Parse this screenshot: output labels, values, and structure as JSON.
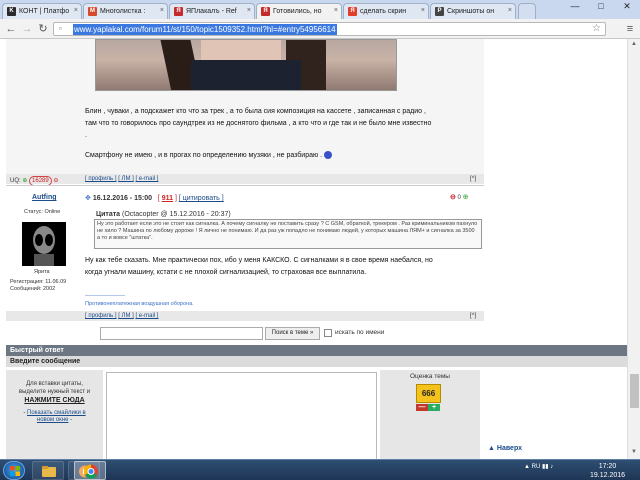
{
  "tabs": [
    {
      "label": "КОНТ | Платфо",
      "icon": "kont-icon",
      "color": "#2a2a2a"
    },
    {
      "label": "Многолистка :",
      "icon": "multilist-icon",
      "color": "#d64b2a"
    },
    {
      "label": "ЯПлакалъ - Ref",
      "icon": "yaplakal-icon",
      "color": "#c62b2b"
    },
    {
      "label": "Готовились, но",
      "icon": "yaplakal-icon",
      "color": "#c62b2b"
    },
    {
      "label": "сделать скрин",
      "icon": "yandex-icon",
      "color": "#e03d2b"
    },
    {
      "label": "Скриншоты он",
      "icon": "p-icon",
      "color": "#444444"
    }
  ],
  "window": {
    "minimize": "—",
    "maximize": "□",
    "close": "✕"
  },
  "address": {
    "url": "www.yaplakal.com/forum11/st/150/topic1509352.html?hl=#entry54956614"
  },
  "post1": {
    "text1": "Блин , чуваки , а подскажет кто что за трек , а то была сия композиция на кассете , записанная с радио ,",
    "text2": "там что то говорилось про саундтрек из не доснятого фильма , а кто что и где так и не было мне известно",
    "text3": ".",
    "text4": "Смартфону не имею , и в прогах по определению музяки , не разбираю .",
    "uq_label": "UQ:",
    "uq_value": "16289",
    "links": [
      "[ профиль ]",
      "[ ЛМ ]",
      "[ e-mail ]"
    ],
    "up": "[^]"
  },
  "post2": {
    "author": "Autfing",
    "status": "Статус: Online",
    "date": "16.12.2016 - 15:00",
    "rep_num": "911",
    "quote_link": "[ цитировать ]",
    "score": "0",
    "user_name": "Ярита",
    "registration": "Регистрация: 11.06.09",
    "messages": "Сообщений: 2002",
    "quote_title": "Цитата",
    "quote_meta": "(Octacopter @ 15.12.2016 - 20:37)",
    "quote_text": "Ну это работает если это не стоит как сигналка. А почему сигналку не поставить сразу ? С GSM, обраткой, трекером . Раз криминальником пахнуло не хило ? Машина по любому дороже ! Я лично не понимаю. И да раз уж попадло не понимаю людей, у которых машина ЛЯМ+ и сигналка за 3500 а то и вовсе \"штатка\".",
    "text1": "Ну как тебе сказать. Мне практически пох, ибо у меня КАКСКО. С сигналками я в свое время наебался, но",
    "text2": "когда угнали машину, кстати с не плохой сигнализацией, то страховая все выплатила.",
    "sig_dashes": "--------------------",
    "signature": "Противонеплатежная воздушная оборона.",
    "links": [
      "[ профиль ]",
      "[ ЛМ ]",
      "[ e-mail ]"
    ],
    "up": "[^]"
  },
  "search": {
    "button": "Поиск в теме »",
    "checkbox_label": "искать по имени"
  },
  "reply": {
    "header": "Быстрый ответ",
    "subheader": "Введите сообщение",
    "hint1": "Для вставки цитаты,",
    "hint2": "выделите нужный текст и",
    "hint3": "НАЖМИТЕ СЮДА",
    "smileys": "Показать смайлики в",
    "smileys2": "новом окне",
    "rating_title": "Оценка темы",
    "rating_value": "666",
    "rating_minus": "—",
    "rating_plus": "+",
    "back_top": "Наверх"
  },
  "taskbar": {
    "lang": "RU",
    "time": "17:20",
    "date": "19.12.2016"
  }
}
